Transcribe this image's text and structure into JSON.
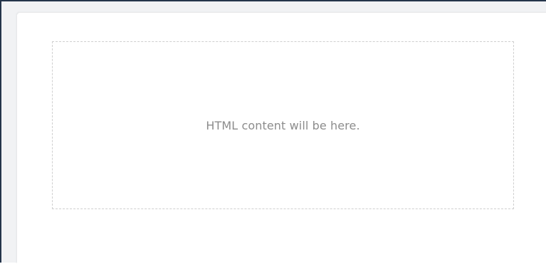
{
  "content_placeholder": {
    "text": "HTML content will be here."
  }
}
